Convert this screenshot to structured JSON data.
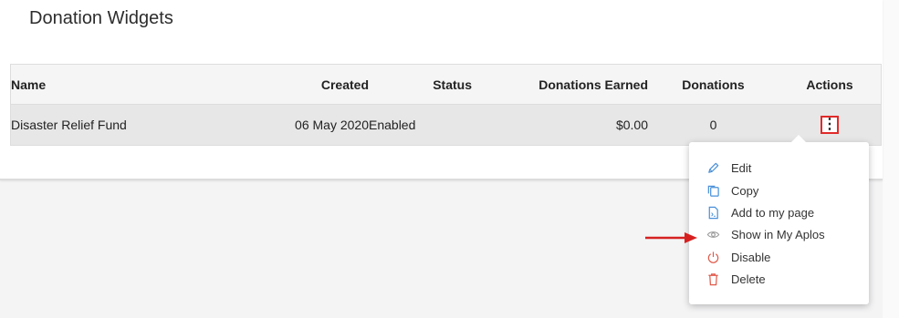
{
  "page": {
    "title": "Donation Widgets"
  },
  "table": {
    "columns": {
      "name": "Name",
      "created": "Created",
      "status": "Status",
      "earned": "Donations Earned",
      "donations": "Donations",
      "actions": "Actions"
    },
    "rows": [
      {
        "name": "Disaster Relief Fund",
        "created": "06 May 2020",
        "status": "Enabled",
        "earned": "$0.00",
        "donations": "0",
        "actions_glyph": "⋮"
      }
    ]
  },
  "menu": {
    "items": [
      {
        "label": "Edit",
        "icon": "pencil-icon",
        "color": "#4a90d9"
      },
      {
        "label": "Copy",
        "icon": "copy-icon",
        "color": "#4a90d9"
      },
      {
        "label": "Add to my page",
        "icon": "add-to-page-icon",
        "color": "#4a90d9"
      },
      {
        "label": "Show in My Aplos",
        "icon": "eye-icon",
        "color": "#999999"
      },
      {
        "label": "Disable",
        "icon": "power-icon",
        "color": "#e05a4a"
      },
      {
        "label": "Delete",
        "icon": "trash-icon",
        "color": "#e05a4a"
      }
    ]
  },
  "colors": {
    "accent_red": "#e12a2a",
    "arrow_red": "#d62020"
  }
}
